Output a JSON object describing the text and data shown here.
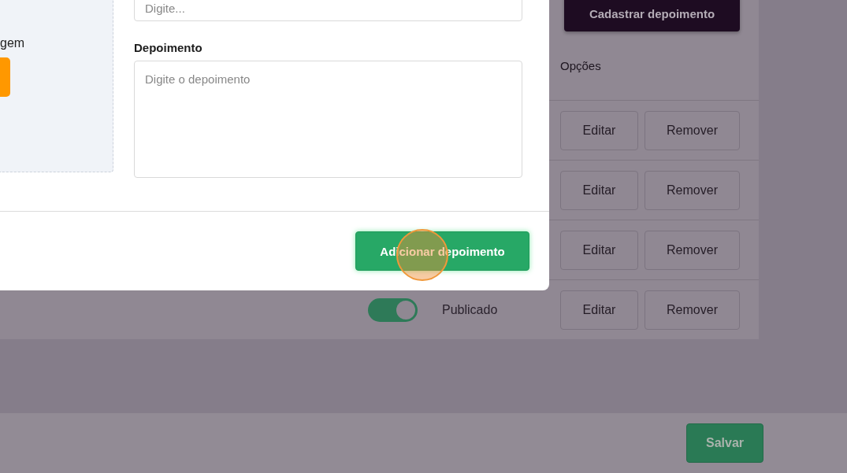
{
  "page": {
    "register_button": "Cadastrar depoimento",
    "options_header": "Opções",
    "rows": [
      {
        "edit": "Editar",
        "remove": "Remover"
      },
      {
        "edit": "Editar",
        "remove": "Remover"
      },
      {
        "edit": "Editar",
        "remove": "Remover"
      },
      {
        "edit": "Editar",
        "remove": "Remover",
        "published": {
          "on": true,
          "status": "Publicado"
        }
      }
    ],
    "save_button": "Salvar"
  },
  "modal": {
    "image_label": "gem",
    "name_field": {
      "placeholder": "Digite..."
    },
    "testimonial_label": "Depoimento",
    "testimonial_field": {
      "placeholder": "Digite o depoimento"
    },
    "add_button": "Adicionar depoimento"
  }
}
